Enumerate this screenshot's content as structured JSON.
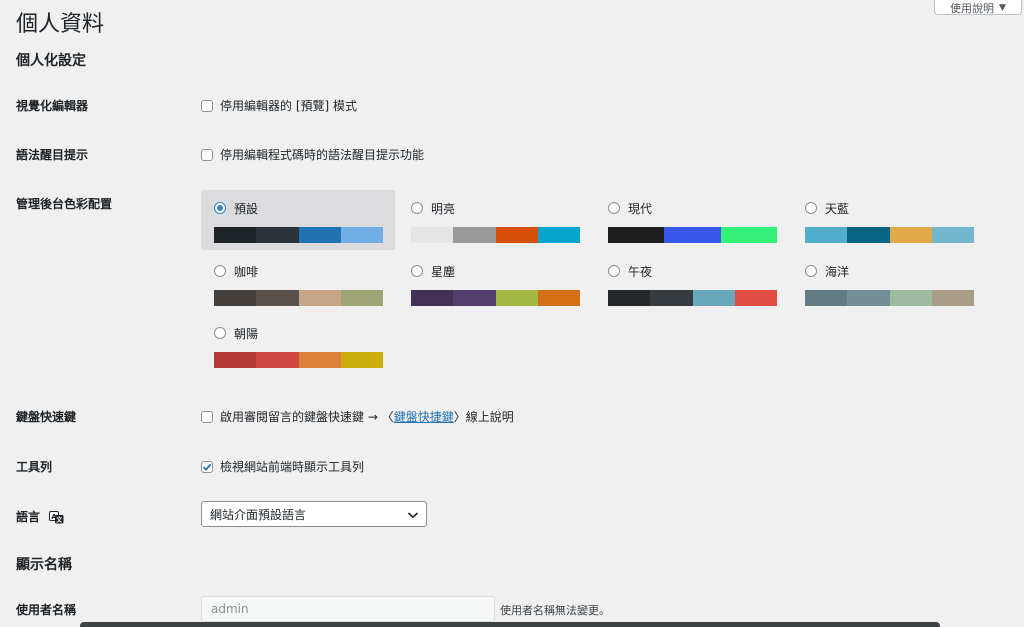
{
  "page": {
    "title": "個人資料",
    "help_label": "使用說明"
  },
  "personal": {
    "title": "個人化設定",
    "visual_editor": {
      "label": "視覺化編輯器",
      "checkbox_text": "停用編輯器的 [預覽] 模式",
      "checked": false
    },
    "syntax_highlight": {
      "label": "語法醒目提示",
      "checkbox_text": "停用編輯程式碼時的語法醒目提示功能",
      "checked": false
    },
    "color_scheme": {
      "label": "管理後台色彩配置",
      "schemes": [
        {
          "name": "預設",
          "selected": true,
          "colors": [
            "#1d2327",
            "#2c3338",
            "#2271b1",
            "#72aee6"
          ]
        },
        {
          "name": "明亮",
          "selected": false,
          "colors": [
            "#e5e5e5",
            "#999999",
            "#d64e07",
            "#04a4cc"
          ]
        },
        {
          "name": "現代",
          "selected": false,
          "colors": [
            "#1e1e1e",
            "#3858e9",
            "#33f078"
          ]
        },
        {
          "name": "天藍",
          "selected": false,
          "colors": [
            "#52accc",
            "#096484",
            "#e1a948",
            "#74b6ce"
          ]
        },
        {
          "name": "咖啡",
          "selected": false,
          "colors": [
            "#46403c",
            "#59524c",
            "#c7a589",
            "#9ea476"
          ]
        },
        {
          "name": "星塵",
          "selected": false,
          "colors": [
            "#413256",
            "#523f6d",
            "#a3b745",
            "#d46f15"
          ]
        },
        {
          "name": "午夜",
          "selected": false,
          "colors": [
            "#25282b",
            "#363b3f",
            "#69a8bb",
            "#e14d43"
          ]
        },
        {
          "name": "海洋",
          "selected": false,
          "colors": [
            "#627c83",
            "#738e96",
            "#9ebaa0",
            "#aa9d88"
          ]
        },
        {
          "name": "朝陽",
          "selected": false,
          "colors": [
            "#b43c38",
            "#cf4944",
            "#dd823b",
            "#ccaf0b"
          ]
        }
      ]
    },
    "keyboard_shortcuts": {
      "label": "鍵盤快速鍵",
      "text_before": "啟用審閱留言的鍵盤快速鍵 → 〈",
      "link_text": "鍵盤快捷鍵",
      "text_after": "〉線上說明",
      "checked": false
    },
    "toolbar": {
      "label": "工具列",
      "checkbox_text": "檢視網站前端時顯示工具列",
      "checked": true
    },
    "language": {
      "label": "語言",
      "selected": "網站介面預設語言"
    }
  },
  "name": {
    "title": "顯示名稱",
    "username": {
      "label": "使用者名稱",
      "value": "admin",
      "description": "使用者名稱無法變更。"
    }
  }
}
